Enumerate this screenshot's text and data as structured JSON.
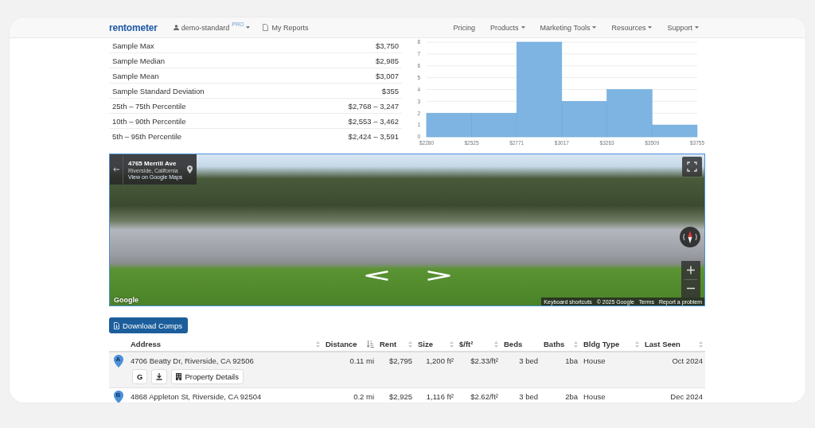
{
  "header": {
    "logo": "rentometer",
    "account": {
      "name": "demo-standard",
      "badge": "PRO"
    },
    "reports": "My Reports",
    "nav": [
      {
        "label": "Pricing",
        "dropdown": false
      },
      {
        "label": "Products",
        "dropdown": true
      },
      {
        "label": "Marketing Tools",
        "dropdown": true
      },
      {
        "label": "Resources",
        "dropdown": true
      },
      {
        "label": "Support",
        "dropdown": true
      }
    ]
  },
  "stats": [
    {
      "label": "Sample Max",
      "value": "$3,750"
    },
    {
      "label": "Sample Median",
      "value": "$2,985"
    },
    {
      "label": "Sample Mean",
      "value": "$3,007"
    },
    {
      "label": "Sample Standard Deviation",
      "value": "$355"
    },
    {
      "label": "25th – 75th Percentile",
      "value": "$2,768 – 3,247"
    },
    {
      "label": "10th – 90th Percentile",
      "value": "$2,553 – 3,462"
    },
    {
      "label": "5th – 95th Percentile",
      "value": "$2,424 – 3,591"
    }
  ],
  "histogram": {
    "chart_data": {
      "type": "bar",
      "x": [
        2402.5,
        2648,
        2894,
        3140,
        3386,
        3632
      ],
      "series": [
        {
          "color": "#7db4e2",
          "values": [
            2,
            2,
            8,
            3,
            4,
            1
          ]
        }
      ],
      "xlim": [
        2280,
        3755
      ],
      "ylim": [
        0,
        8
      ],
      "xticks": [
        {
          "value": 2280,
          "label": "$2280"
        },
        {
          "value": 2525,
          "label": "$2525"
        },
        {
          "value": 2771,
          "label": "$2771"
        },
        {
          "value": 3017,
          "label": "$3017"
        },
        {
          "value": 3263,
          "label": "$3263"
        },
        {
          "value": 3509,
          "label": "$3509"
        },
        {
          "value": 3755,
          "label": "$3755"
        }
      ],
      "yticks": [
        0,
        1,
        2,
        3,
        4,
        5,
        6,
        7,
        8
      ],
      "grid": true
    }
  },
  "street_view": {
    "address": "4765 Merrill Ave",
    "city": "Riverside, California",
    "link": "View on Google Maps",
    "logo": "Google",
    "attribution": {
      "shortcuts": "Keyboard shortcuts",
      "copyright": "© 2025 Google",
      "terms": "Terms",
      "report": "Report a problem"
    }
  },
  "download_button": "Download Comps",
  "comps": {
    "columns": [
      {
        "label": "Address",
        "kind": "text",
        "sortable": true,
        "sorted": false
      },
      {
        "label": "Distance",
        "kind": "number",
        "sortable": true,
        "sorted": true
      },
      {
        "label": "Rent",
        "kind": "number",
        "sortable": true,
        "sorted": false
      },
      {
        "label": "Size",
        "kind": "number",
        "sortable": true,
        "sorted": false
      },
      {
        "label": "$/ft²",
        "kind": "number",
        "sortable": true,
        "sorted": false
      },
      {
        "label": "Beds",
        "kind": "number",
        "sortable": false,
        "sorted": false
      },
      {
        "label": "Baths",
        "kind": "number",
        "sortable": true,
        "sorted": false
      },
      {
        "label": "Bldg Type",
        "kind": "text",
        "sortable": true,
        "sorted": false
      },
      {
        "label": "Last Seen",
        "kind": "date",
        "sortable": true,
        "sorted": false
      }
    ],
    "rows": [
      {
        "marker": "A",
        "selected": true,
        "cells": [
          "4706 Beatty Dr, Riverside, CA 92506",
          "0.11 mi",
          "$2,795",
          "1,200 ft²",
          "$2.33/ft²",
          "3 bed",
          "1ba",
          "House",
          "Oct 2024"
        ],
        "actions": [
          {
            "kind": "google",
            "label": "G"
          },
          {
            "kind": "download"
          },
          {
            "kind": "details",
            "label": "Property Details"
          }
        ]
      },
      {
        "marker": "B",
        "selected": false,
        "cells": [
          "4868 Appleton St, Riverside, CA 92504",
          "0.2 mi",
          "$2,925",
          "1,116 ft²",
          "$2.62/ft²",
          "3 bed",
          "2ba",
          "House",
          "Dec 2024"
        ]
      }
    ]
  }
}
